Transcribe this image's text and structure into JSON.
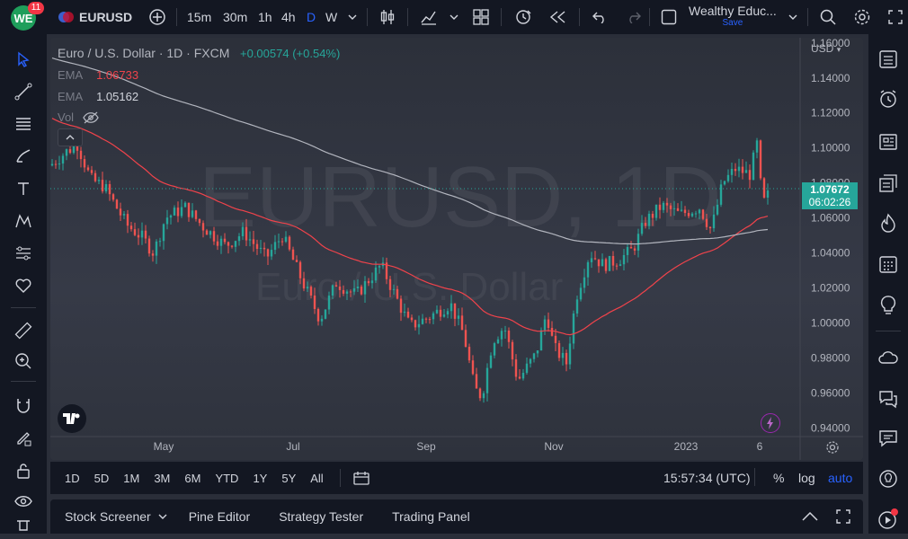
{
  "topbar": {
    "avatar_text": "WE",
    "notification_count": "11",
    "symbol": "EURUSD",
    "intervals": [
      "15m",
      "30m",
      "1h",
      "4h",
      "D",
      "W"
    ],
    "active_interval": "D",
    "layout_name": "Wealthy Educ...",
    "layout_sub": "Save"
  },
  "chart": {
    "title": "Euro / U.S. Dollar · 1D · FXCM",
    "change": "+0.00574 (+0.54%)",
    "ema1_label": "EMA",
    "ema1_value": "1.06733",
    "ema2_label": "EMA",
    "ema2_value": "1.05162",
    "vol_label": "Vol",
    "watermark_symbol": "EURUSD, 1D",
    "watermark_name": "Euro / U.S. Dollar",
    "currency": "USD",
    "price_label": "1.07672",
    "countdown": "06:02:26"
  },
  "chart_data": {
    "type": "candlestick",
    "y_ticks": [
      "1.16000",
      "1.14000",
      "1.12000",
      "1.10000",
      "1.08000",
      "1.06000",
      "1.04000",
      "1.02000",
      "1.00000",
      "0.98000",
      "0.96000",
      "0.94000"
    ],
    "ylim": [
      0.935,
      1.163
    ],
    "x_ticks": [
      "May",
      "Jul",
      "Sep",
      "Nov",
      "2023",
      "6"
    ],
    "last_price": 1.07672,
    "ema_fast": 1.06733,
    "ema_slow": 1.05162,
    "colors": {
      "up": "#26a69a",
      "down": "#ef5350",
      "ema_fast": "#f0434b",
      "ema_slow": "#b2b5be"
    }
  },
  "bottombar": {
    "ranges": [
      "1D",
      "5D",
      "1M",
      "3M",
      "6M",
      "YTD",
      "1Y",
      "5Y",
      "All"
    ],
    "time": "15:57:34 (UTC)",
    "percent": "%",
    "log": "log",
    "auto": "auto"
  },
  "footer": {
    "tabs": [
      "Stock Screener",
      "Pine Editor",
      "Strategy Tester",
      "Trading Panel"
    ]
  }
}
